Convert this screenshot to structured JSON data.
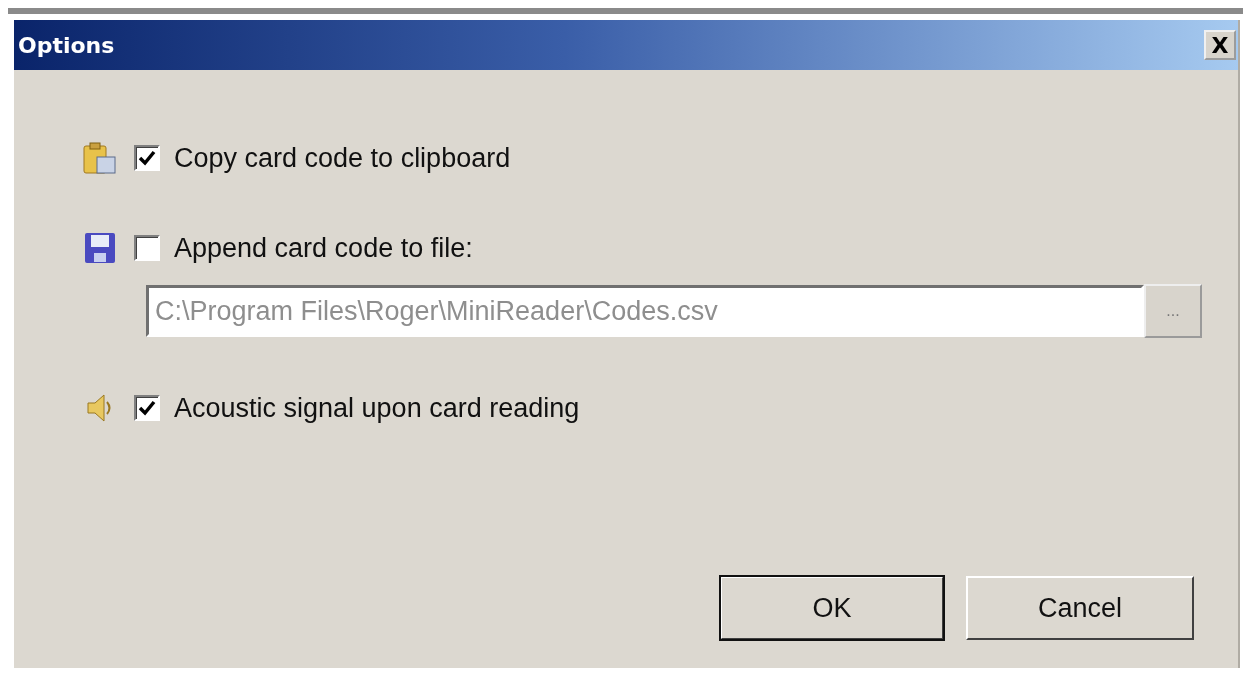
{
  "window": {
    "title": "Options",
    "close": "X"
  },
  "options": [
    {
      "label": "Copy card code to clipboard",
      "checked": true
    },
    {
      "label": "Append card code to file:",
      "checked": false,
      "file": {
        "value": "C:\\Program Files\\Roger\\MiniReader\\Codes.csv",
        "disabled": true,
        "browse": "..."
      }
    },
    {
      "label": "Acoustic signal upon card reading",
      "checked": true
    }
  ],
  "buttons": [
    {
      "label": "OK",
      "default": true
    },
    {
      "label": "Cancel",
      "default": false
    }
  ]
}
